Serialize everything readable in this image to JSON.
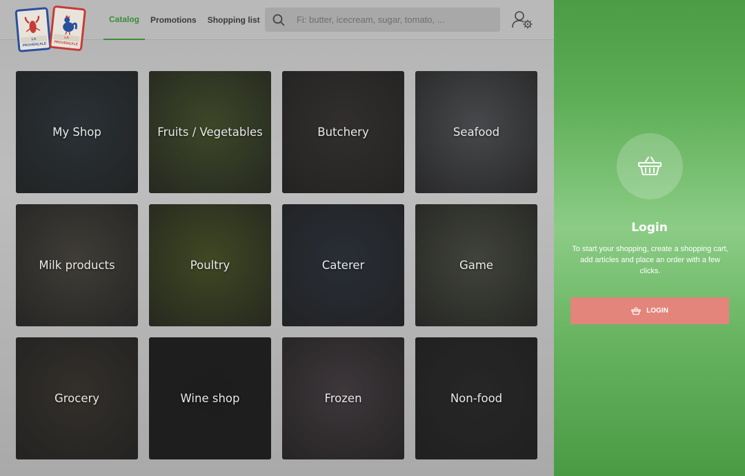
{
  "header": {
    "logo_text_left": "LA PROVENÇALE",
    "logo_text_right": "LA PROVENÇALE",
    "nav": [
      {
        "label": "Catalog"
      },
      {
        "label": "Promotions"
      },
      {
        "label": "Shopping list"
      }
    ],
    "search": {
      "placeholder": "Fi: butter, icecream, sugar, tomato, ..."
    },
    "icons": [
      "search-icon",
      "user-settings-icon"
    ]
  },
  "categories": [
    {
      "label": "My Shop",
      "color": "#3f4a50"
    },
    {
      "label": "Fruits / Vegetables",
      "color": "#5b6a3a"
    },
    {
      "label": "Butchery",
      "color": "#4a4644"
    },
    {
      "label": "Seafood",
      "color": "#6a6c70"
    },
    {
      "label": "Milk products",
      "color": "#5e5a52"
    },
    {
      "label": "Poultry",
      "color": "#5e6b34"
    },
    {
      "label": "Caterer",
      "color": "#3d4450"
    },
    {
      "label": "Game",
      "color": "#5f6456"
    },
    {
      "label": "Grocery",
      "color": "#4c4740"
    },
    {
      "label": "Wine shop",
      "color": "#2c2c2c"
    },
    {
      "label": "Frozen",
      "color": "#5b5257"
    },
    {
      "label": "Non-food",
      "color": "#393939"
    }
  ],
  "login": {
    "title": "Login",
    "text": "To start your shopping, create a shopping cart, add articles and place an order with a few clicks.",
    "button_label": "LOGIN",
    "icon": "basket-icon"
  },
  "colors": {
    "accent_green": "#3d8c38",
    "panel_green": "#5cad55",
    "login_button": "#e3857a"
  }
}
